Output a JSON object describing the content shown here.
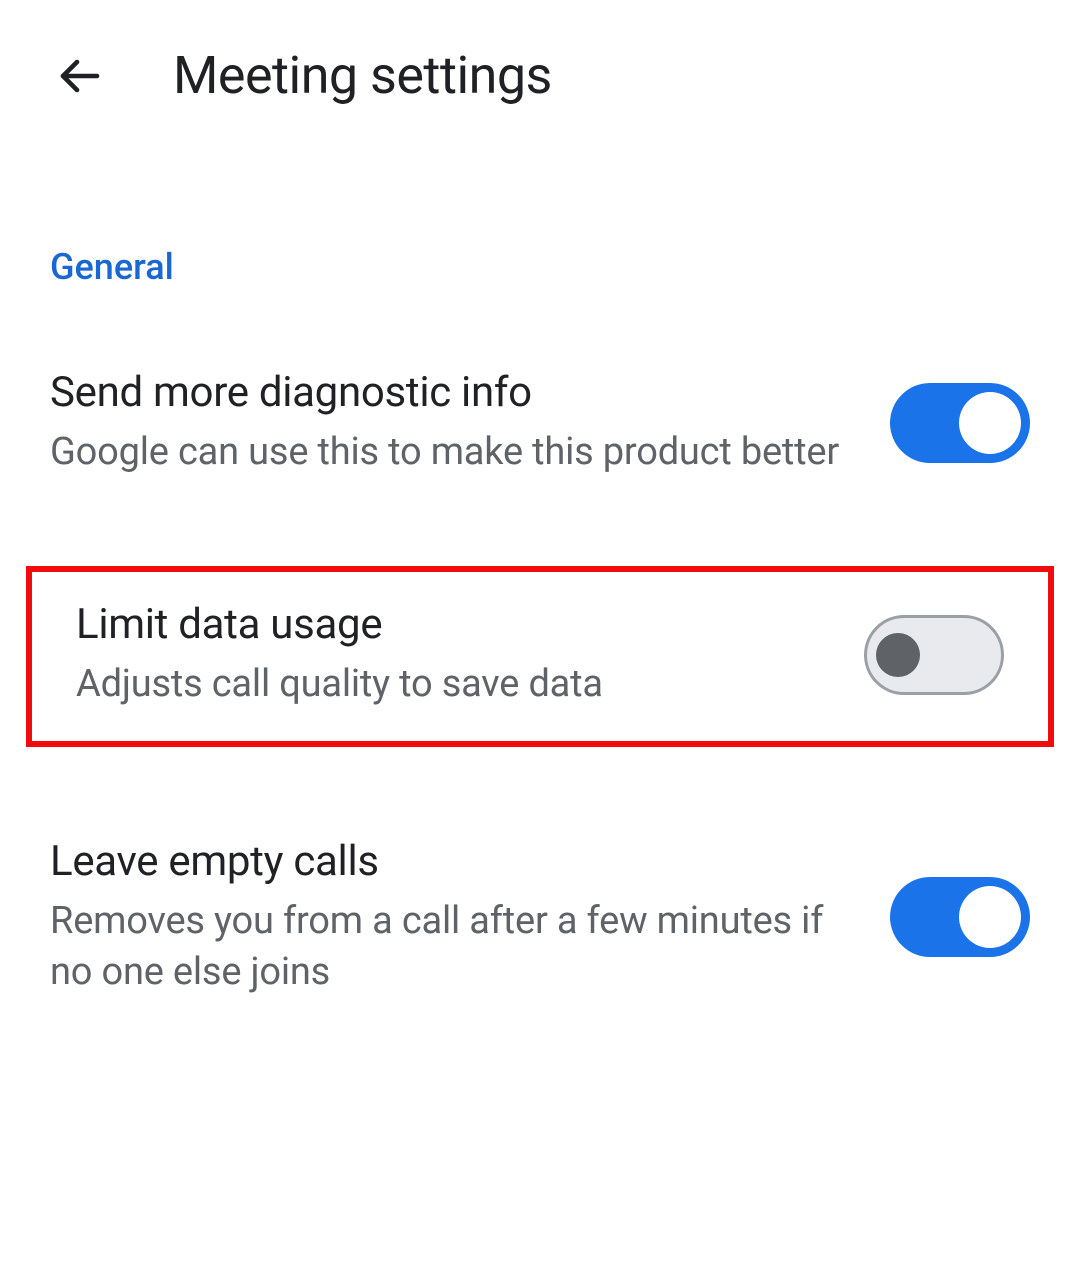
{
  "header": {
    "title": "Meeting settings"
  },
  "section": {
    "label": "General"
  },
  "settings": [
    {
      "title": "Send more diagnostic info",
      "subtitle": "Google can use this to make this product better",
      "enabled": true,
      "highlighted": false
    },
    {
      "title": "Limit data usage",
      "subtitle": "Adjusts call quality to save data",
      "enabled": false,
      "highlighted": true
    },
    {
      "title": "Leave empty calls",
      "subtitle": "Removes you from a call after a few minutes if no one else joins",
      "enabled": true,
      "highlighted": false
    }
  ]
}
